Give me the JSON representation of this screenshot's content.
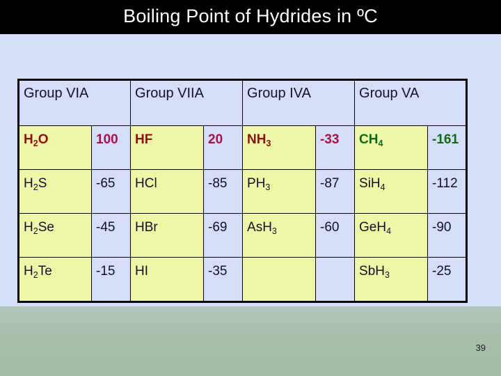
{
  "slide": {
    "title": "Boiling Point of Hydrides in ºC",
    "page_number": "39",
    "colors": {
      "title_bar": "#000000",
      "title_text": "#ffffff",
      "background_top": "#d5ddf8",
      "background_bottom": "#a3bda6",
      "cell_formula_bg": "#eff6a5",
      "cell_value_bg": "#d5ddf8",
      "border": "#000000",
      "accent_maroon": "#8c1111",
      "accent_crimson": "#a8124a",
      "accent_green": "#0d6b17"
    }
  },
  "table": {
    "headers": [
      "Group VIA",
      "Group VIIA",
      "Group IVA",
      "Group VA"
    ],
    "rows": [
      {
        "highlight": true,
        "cells": [
          {
            "formula_html": "H<sub>2</sub>O",
            "formula_text": "H2O",
            "color": "maroon"
          },
          {
            "value": "100",
            "color": "crimson"
          },
          {
            "formula_html": "HF",
            "formula_text": "HF",
            "color": "maroon"
          },
          {
            "value": "20",
            "color": "crimson"
          },
          {
            "formula_html": "NH<sub>3</sub>",
            "formula_text": "NH3",
            "color": "maroon"
          },
          {
            "value": "-33",
            "color": "crimson"
          },
          {
            "formula_html": "CH<sub>4</sub>",
            "formula_text": "CH4",
            "color": "green"
          },
          {
            "value": "-161",
            "color": "green"
          }
        ]
      },
      {
        "highlight": false,
        "cells": [
          {
            "formula_html": "H<sub>2</sub>S",
            "formula_text": "H2S",
            "color": "default"
          },
          {
            "value": "-65",
            "color": "default"
          },
          {
            "formula_html": "HCl",
            "formula_text": "HCl",
            "color": "default"
          },
          {
            "value": "-85",
            "color": "default"
          },
          {
            "formula_html": "PH<sub>3</sub>",
            "formula_text": "PH3",
            "color": "default"
          },
          {
            "value": "-87",
            "color": "default"
          },
          {
            "formula_html": "SiH<sub>4</sub>",
            "formula_text": "SiH4",
            "color": "default"
          },
          {
            "value": "-112",
            "color": "default"
          }
        ]
      },
      {
        "highlight": false,
        "cells": [
          {
            "formula_html": "H<sub>2</sub>Se",
            "formula_text": "H2Se",
            "color": "default"
          },
          {
            "value": "-45",
            "color": "default"
          },
          {
            "formula_html": "HBr",
            "formula_text": "HBr",
            "color": "default"
          },
          {
            "value": "-69",
            "color": "default"
          },
          {
            "formula_html": "AsH<sub>3</sub>",
            "formula_text": "AsH3",
            "color": "default"
          },
          {
            "value": "-60",
            "color": "default"
          },
          {
            "formula_html": "GeH<sub>4</sub>",
            "formula_text": "GeH4",
            "color": "default"
          },
          {
            "value": "-90",
            "color": "default"
          }
        ]
      },
      {
        "highlight": false,
        "cells": [
          {
            "formula_html": "H<sub>2</sub>Te",
            "formula_text": "H2Te",
            "color": "default"
          },
          {
            "value": "-15",
            "color": "default"
          },
          {
            "formula_html": "HI",
            "formula_text": "HI",
            "color": "default"
          },
          {
            "value": "-35",
            "color": "default"
          },
          {
            "formula_html": "",
            "formula_text": "",
            "color": "default"
          },
          {
            "value": "",
            "color": "default"
          },
          {
            "formula_html": "SbH<sub>3</sub>",
            "formula_text": "SbH3",
            "color": "default"
          },
          {
            "value": "-25",
            "color": "default"
          }
        ]
      }
    ]
  }
}
